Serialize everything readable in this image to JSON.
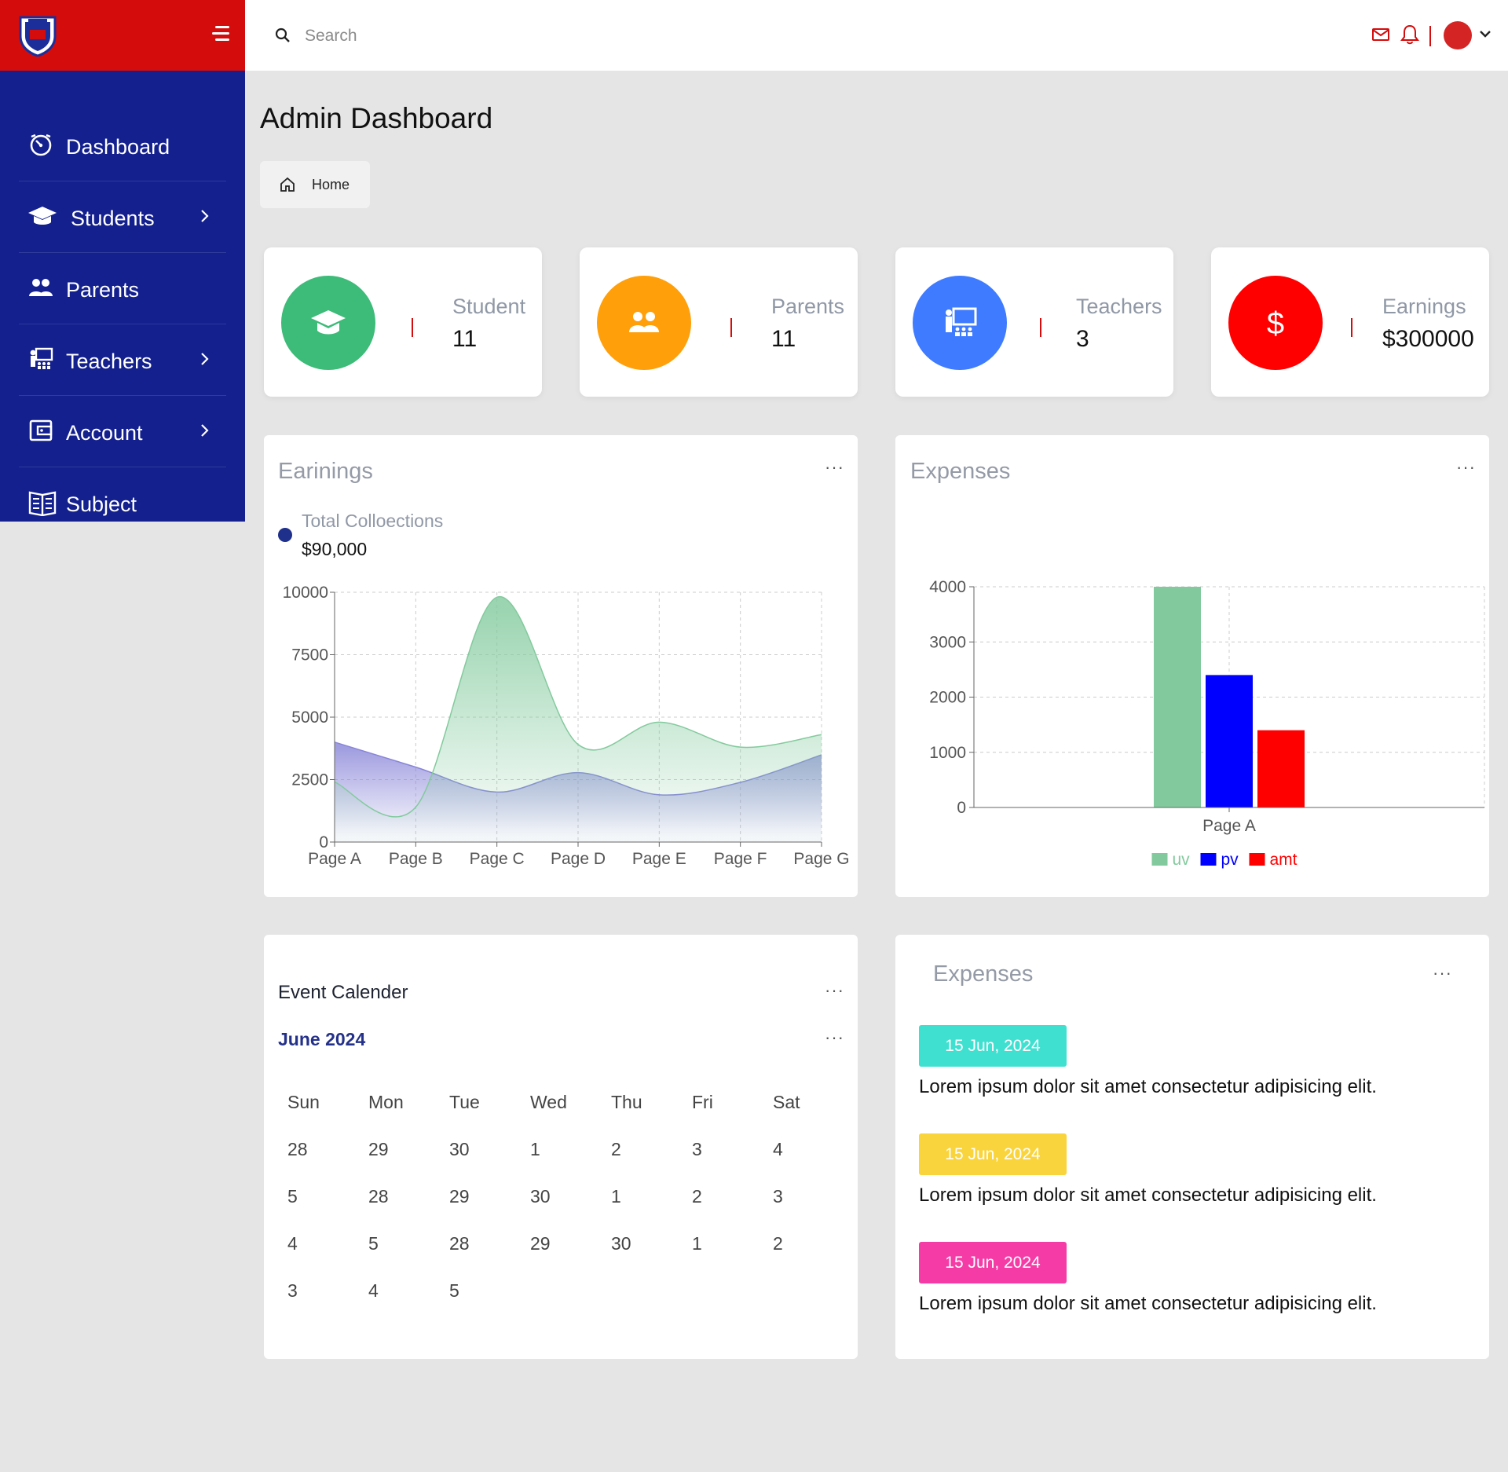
{
  "app": {
    "logo_name": "school-crest-logo"
  },
  "sidebar": {
    "items": [
      {
        "label": "Dashboard",
        "icon": "dashboard-icon",
        "has_submenu": false
      },
      {
        "label": "Students",
        "icon": "graduation-cap-icon",
        "has_submenu": true
      },
      {
        "label": "Parents",
        "icon": "users-icon",
        "has_submenu": false
      },
      {
        "label": "Teachers",
        "icon": "teacher-icon",
        "has_submenu": true
      },
      {
        "label": "Account",
        "icon": "wallet-icon",
        "has_submenu": true
      },
      {
        "label": "Subject",
        "icon": "book-icon",
        "has_submenu": false
      }
    ]
  },
  "topbar": {
    "search_placeholder": "Search"
  },
  "header": {
    "title": "Admin Dashboard",
    "breadcrumb": "Home"
  },
  "stats": [
    {
      "label": "Student",
      "value": "11",
      "color": "#3dbb78",
      "icon": "graduation-cap-icon"
    },
    {
      "label": "Parents",
      "value": "11",
      "color": "#ff9f0a",
      "icon": "users-icon"
    },
    {
      "label": "Teachers",
      "value": "3",
      "color": "#3f7bff",
      "icon": "teacher-icon"
    },
    {
      "label": "Earnings",
      "value": "$300000",
      "color": "#ff0000",
      "icon": "dollar-icon"
    }
  ],
  "earnings_panel": {
    "title": "Earinings",
    "legend_label": "Total Colloections",
    "legend_value": "$90,000"
  },
  "expenses_chart_panel": {
    "title": "Expenses"
  },
  "calendar": {
    "title": "Event Calender",
    "month": "June 2024",
    "weekdays": [
      "Sun",
      "Mon",
      "Tue",
      "Wed",
      "Thu",
      "Fri",
      "Sat"
    ],
    "weeks": [
      [
        "28",
        "29",
        "30",
        "1",
        "2",
        "3",
        "4"
      ],
      [
        "5",
        "28",
        "29",
        "30",
        "1",
        "2",
        "3"
      ],
      [
        "4",
        "5",
        "28",
        "29",
        "30",
        "1",
        "2"
      ],
      [
        "3",
        "4",
        "5",
        "",
        "",
        "",
        ""
      ]
    ]
  },
  "expenses_list": {
    "title": "Expenses",
    "items": [
      {
        "date": "15 Jun, 2024",
        "text": "Lorem ipsum dolor sit amet consectetur adipisicing elit.",
        "color": "#40e0d0"
      },
      {
        "date": "15 Jun, 2024",
        "text": "Lorem ipsum dolor sit amet consectetur adipisicing elit.",
        "color": "#fad43c"
      },
      {
        "date": "15 Jun, 2024",
        "text": "Lorem ipsum dolor sit amet consectetur adipisicing elit.",
        "color": "#f53ca6"
      }
    ]
  },
  "chart_data": [
    {
      "type": "area",
      "title": "",
      "categories": [
        "Page A",
        "Page B",
        "Page C",
        "Page D",
        "Page E",
        "Page F",
        "Page G"
      ],
      "series": [
        {
          "name": "",
          "values": [
            4000,
            3000,
            2000,
            2780,
            1890,
            2390,
            3490
          ],
          "color": "#8884d8"
        },
        {
          "name": "",
          "values": [
            2400,
            1398,
            9800,
            3908,
            4800,
            3800,
            4300
          ],
          "color": "#82ca9d"
        }
      ],
      "yticks": [
        "0",
        "2500",
        "5000",
        "7500",
        "10000"
      ],
      "ylim": [
        0,
        10000
      ],
      "grid": true
    },
    {
      "type": "bar",
      "title": "",
      "categories": [
        "Page A"
      ],
      "series": [
        {
          "name": "uv",
          "values": [
            4000
          ],
          "color": "#82ca9d"
        },
        {
          "name": "pv",
          "values": [
            2400
          ],
          "color": "#0000ff"
        },
        {
          "name": "amt",
          "values": [
            1400
          ],
          "color": "#ff0000"
        }
      ],
      "yticks": [
        "0",
        "1000",
        "2000",
        "3000",
        "4000"
      ],
      "ylim": [
        0,
        4000
      ],
      "grid": true,
      "legend_position": "bottom"
    }
  ]
}
